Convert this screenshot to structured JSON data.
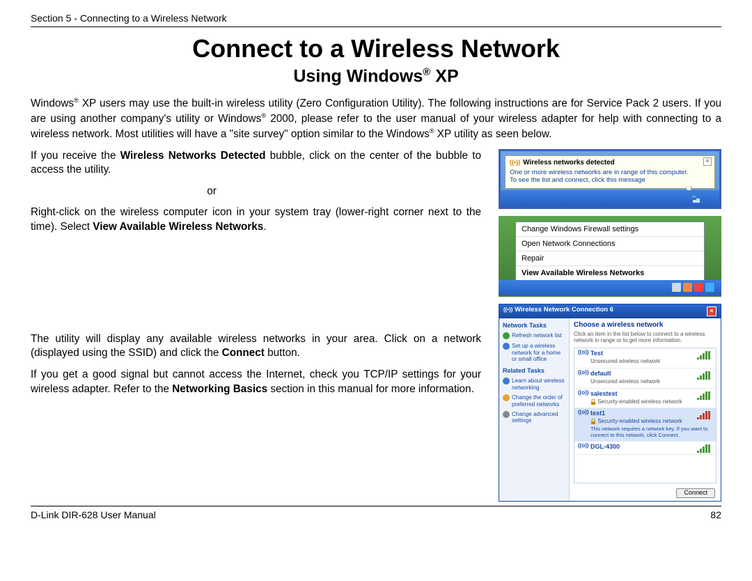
{
  "header": {
    "section": "Section 5 - Connecting to a Wireless Network"
  },
  "title": "Connect to a Wireless Network",
  "subtitle_pre": "Using Windows",
  "subtitle_post": " XP",
  "intro_p1": "Windows",
  "intro_p1b": " XP users may use the built-in wireless utility (Zero Configuration Utility). The following instructions are for Service Pack 2 users.  If you are using another company's utility or Windows",
  "intro_p1c": " 2000, please refer to the user manual of your wireless adapter for help with connecting to a wireless network. Most utilities will have a \"site survey\" option similar to the Windows",
  "intro_p1d": " XP utility as seen below.",
  "left": {
    "p2a": "If you receive the ",
    "p2bold": "Wireless Networks Detected",
    "p2b": " bubble, click on the center of the bubble to access the utility.",
    "or": "or",
    "p3a": "Right-click on the wireless computer icon in your system tray (lower-right corner next to the time). Select ",
    "p3bold": "View Available Wireless Networks",
    "p3b": ".",
    "p4a": "The utility will display any available wireless networks in your area. Click on a network (displayed using the SSID) and click the ",
    "p4bold": "Connect",
    "p4b": " button.",
    "p5a": "If you get a good signal but cannot access the Internet, check you TCP/IP settings for your wireless adapter. Refer to the ",
    "p5bold": "Networking Basics",
    "p5b": " section in this manual for more information."
  },
  "bubble": {
    "title": "Wireless networks detected",
    "line1": "One or more wireless networks are in range of this computer.",
    "line2": "To see the list and connect, click this message"
  },
  "contextMenu": {
    "items": [
      "Change Windows Firewall settings",
      "Open Network Connections",
      "Repair",
      "View Available Wireless Networks"
    ]
  },
  "wlanDialog": {
    "title": "Wireless Network Connection 6",
    "sidebar": {
      "h1": "Network Tasks",
      "i1": "Refresh network list",
      "i2": "Set up a wireless network for a home or small office",
      "h2": "Related Tasks",
      "i3": "Learn about wireless networking",
      "i4": "Change the order of preferred networks",
      "i5": "Change advanced settings"
    },
    "main": {
      "heading": "Choose a wireless network",
      "sub": "Click an item in the list below to connect to a wireless network in range or to get more information.",
      "nets": [
        {
          "ssid": "Test",
          "sec": "Unsecured wireless network",
          "bars": [
            3,
            6,
            9,
            12,
            12
          ],
          "green": true,
          "locked": false
        },
        {
          "ssid": "default",
          "sec": "Unsecured wireless network",
          "bars": [
            3,
            6,
            9,
            12,
            12
          ],
          "green": true,
          "locked": false
        },
        {
          "ssid": "salestest",
          "sec": "Security-enabled wireless network",
          "bars": [
            3,
            6,
            9,
            12,
            12
          ],
          "green": true,
          "locked": true
        },
        {
          "ssid": "test1",
          "sec": "Security-enabled wireless network",
          "bars": [
            3,
            6,
            9,
            12,
            12
          ],
          "green": false,
          "locked": true,
          "extra": "This network requires a network key. If you want to connect to this network, click Connect."
        },
        {
          "ssid": "DGL-4300",
          "sec": "",
          "bars": [
            3,
            6,
            9,
            12,
            12
          ],
          "green": true,
          "locked": false
        }
      ],
      "connect": "Connect"
    }
  },
  "footer": {
    "left": "D-Link DIR-628 User Manual",
    "right": "82"
  }
}
